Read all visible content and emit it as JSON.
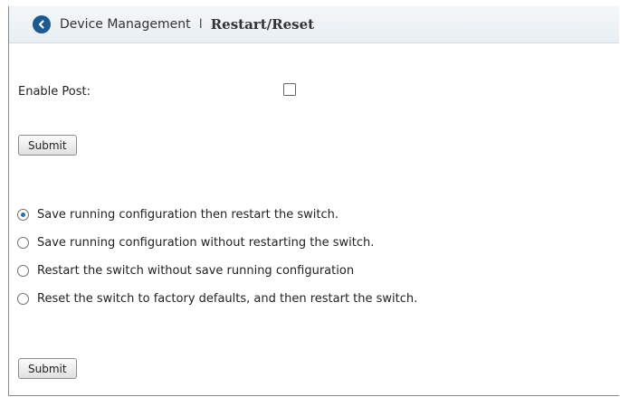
{
  "header": {
    "parent": "Device Management",
    "separator": "I",
    "current": "Restart/Reset"
  },
  "form": {
    "enable_post_label": "Enable Post:",
    "enable_post_checked": false,
    "submit1_label": "Submit",
    "submit2_label": "Submit"
  },
  "options": [
    {
      "label": "Save running configuration then restart the switch.",
      "selected": true
    },
    {
      "label": "Save running configuration without restarting the switch.",
      "selected": false
    },
    {
      "label": "Restart the switch without save running configuration",
      "selected": false
    },
    {
      "label": "Reset the switch to factory defaults, and then restart the switch.",
      "selected": false
    }
  ],
  "icons": {
    "back": "chevron-left-circle-icon"
  },
  "colors": {
    "accent": "#1f5a8f"
  }
}
